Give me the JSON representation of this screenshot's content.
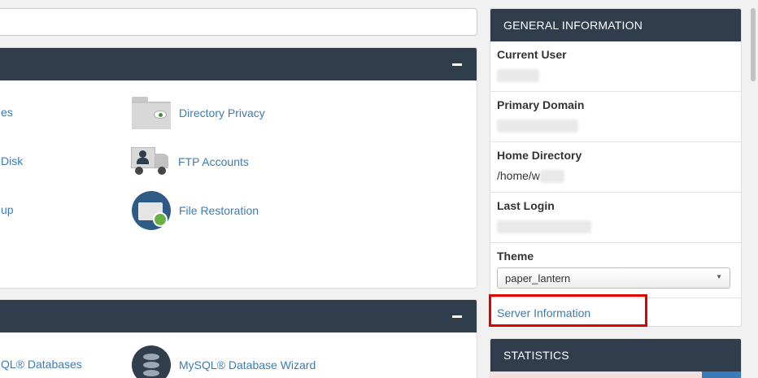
{
  "files_panel": {
    "items": [
      {
        "label": "Directory Privacy",
        "icon": "folder-eye-icon"
      },
      {
        "label": "FTP Accounts",
        "icon": "ftp-truck-icon"
      },
      {
        "label": "File Restoration",
        "icon": "file-restoration-icon"
      }
    ],
    "partial_labels": [
      "es",
      "Disk",
      "up"
    ]
  },
  "databases_panel": {
    "items": [
      {
        "label": "MySQL® Database Wizard",
        "icon": "database-wizard-icon"
      }
    ],
    "partial_labels": [
      "QL® Databases"
    ]
  },
  "general_info": {
    "header": "GENERAL INFORMATION",
    "current_user_label": "Current User",
    "primary_domain_label": "Primary Domain",
    "home_directory_label": "Home Directory",
    "home_directory_value": "/home/w",
    "last_login_label": "Last Login",
    "theme_label": "Theme",
    "theme_value": "paper_lantern",
    "server_info_link": "Server Information"
  },
  "statistics": {
    "header": "STATISTICS"
  },
  "colors": {
    "header_bg": "#2f3d4c",
    "link": "#3a7cb8",
    "highlight": "#e00000"
  }
}
